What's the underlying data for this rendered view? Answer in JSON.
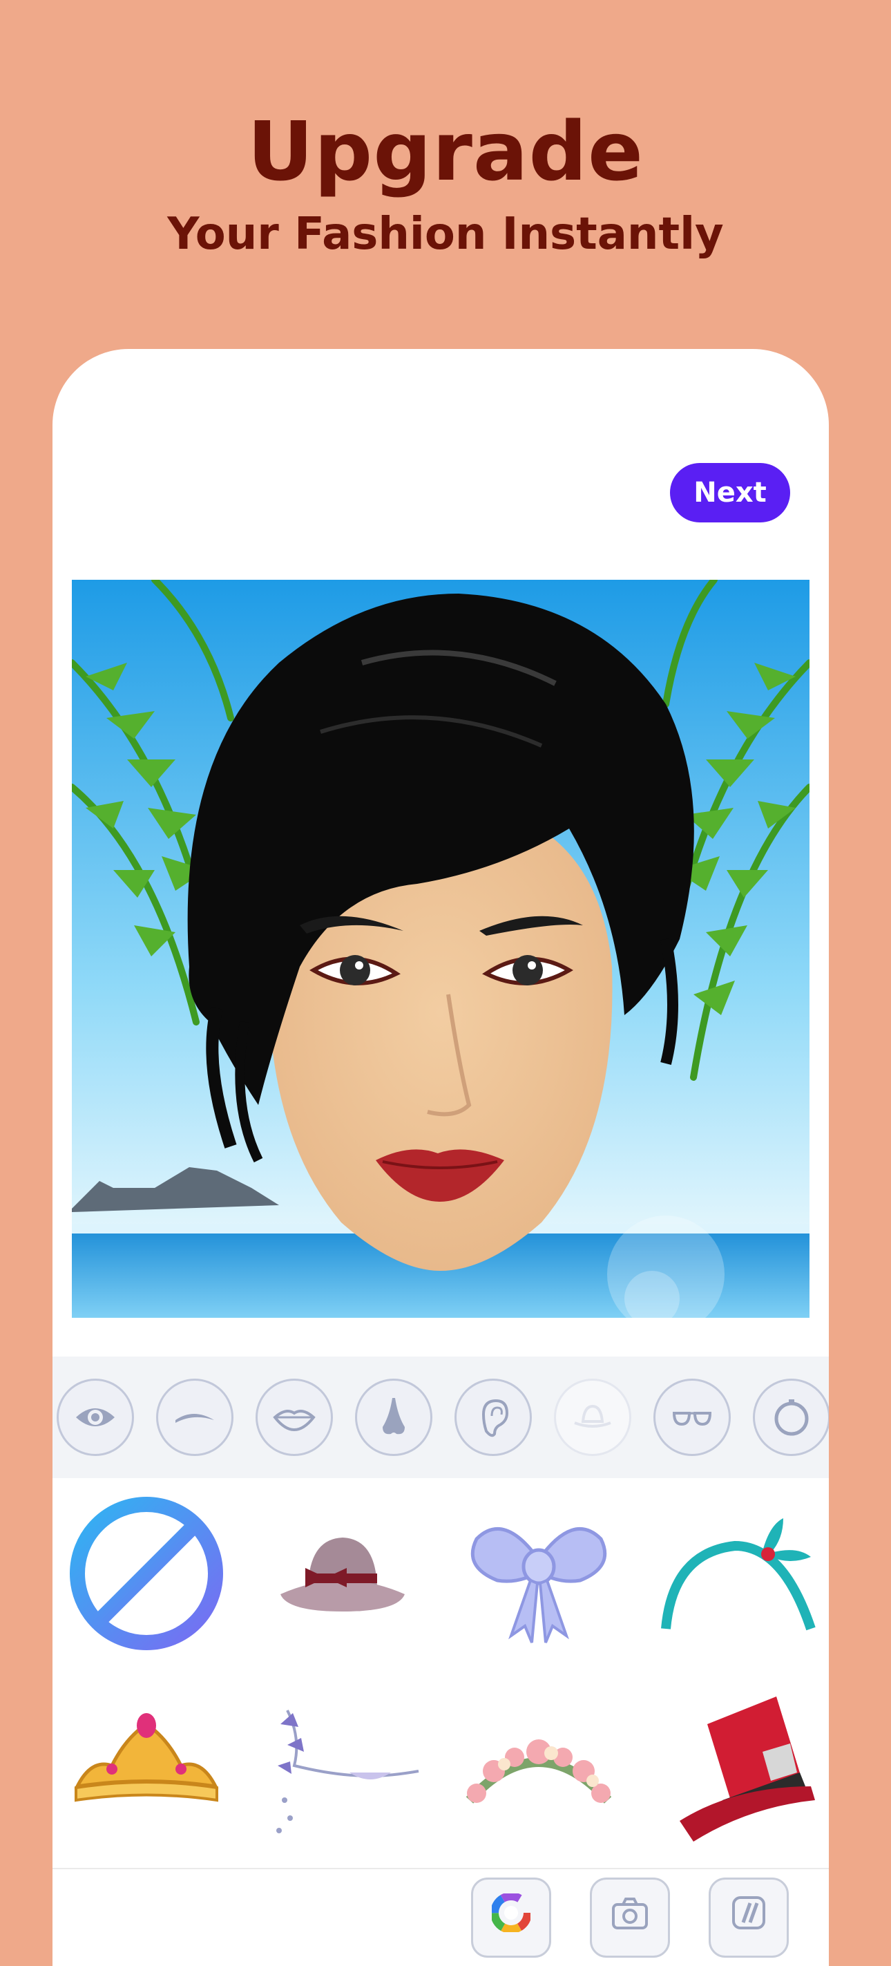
{
  "header": {
    "title": "Upgrade",
    "subtitle": "Your Fashion Instantly"
  },
  "toolbar": {
    "next_label": "Next"
  },
  "features": [
    {
      "icon": "eye-icon"
    },
    {
      "icon": "eyebrow-icon"
    },
    {
      "icon": "lips-icon"
    },
    {
      "icon": "nose-icon"
    },
    {
      "icon": "ear-icon"
    },
    {
      "icon": "hat-icon",
      "selected": true
    },
    {
      "icon": "glasses-icon"
    },
    {
      "icon": "earring-icon"
    }
  ],
  "accessories": [
    {
      "icon": "none-icon"
    },
    {
      "icon": "bucket-hat-icon"
    },
    {
      "icon": "bow-icon"
    },
    {
      "icon": "headband-icon"
    },
    {
      "icon": "tiara-icon"
    },
    {
      "icon": "hair-vine-icon"
    },
    {
      "icon": "flower-crown-icon"
    },
    {
      "icon": "top-hat-icon"
    }
  ],
  "bottom_tools": [
    {
      "icon": "color-wheel-icon"
    },
    {
      "icon": "camera-icon"
    },
    {
      "icon": "eraser-icon"
    }
  ],
  "colors": {
    "background": "#EFA98A",
    "headline": "#6B1307",
    "accent": "#5A1FF3"
  }
}
